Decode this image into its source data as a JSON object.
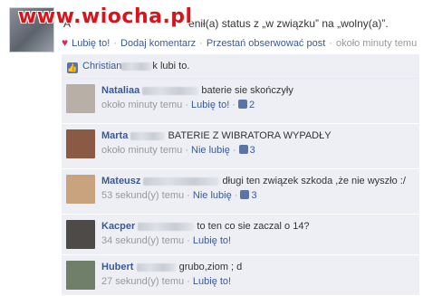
{
  "watermark": "www.wiocha.pl",
  "post": {
    "status_prefix": "A",
    "status_text": "enił(a) status z „w związku” na „wolny(a)”.",
    "meta": {
      "like_label": "Lubię to!",
      "comment_label": "Dodaj komentarz",
      "unfollow_label": "Przestań obserwować post",
      "time": "około minuty temu"
    }
  },
  "likes": {
    "name": "Christian",
    "suffix": "k lubi to."
  },
  "comments": [
    {
      "author": "Nataliaa",
      "text": "baterie sie skończyły",
      "time": "około minuty temu",
      "action": "Lubię to!",
      "likes": "2",
      "avatar_color": "#b8b0a6"
    },
    {
      "author": "Marta",
      "text": "BATERIE Z WIBRATORA WYPADŁY",
      "time": "około minuty temu",
      "action": "Nie lubię",
      "likes": "3",
      "avatar_color": "#8a5a44"
    },
    {
      "author": "Mateusz",
      "text": "długi ten związek szkoda ,że nie wyszło :/",
      "time": "53 sekund(y) temu",
      "action": "Nie lubię",
      "likes": "3",
      "avatar_color": "#c9a27e"
    },
    {
      "author": "Kacper",
      "text": "to ten co sie zaczal o 14?",
      "time": "34 sekund(y) temu",
      "action": "Lubię to!",
      "likes": "",
      "avatar_color": "#4e4a47"
    },
    {
      "author": "Hubert",
      "text": "grubo,ziom ; d",
      "time": "27 sekund(y) temu",
      "action": "Lubię to!",
      "likes": "",
      "avatar_color": "#6f7f6a"
    }
  ]
}
